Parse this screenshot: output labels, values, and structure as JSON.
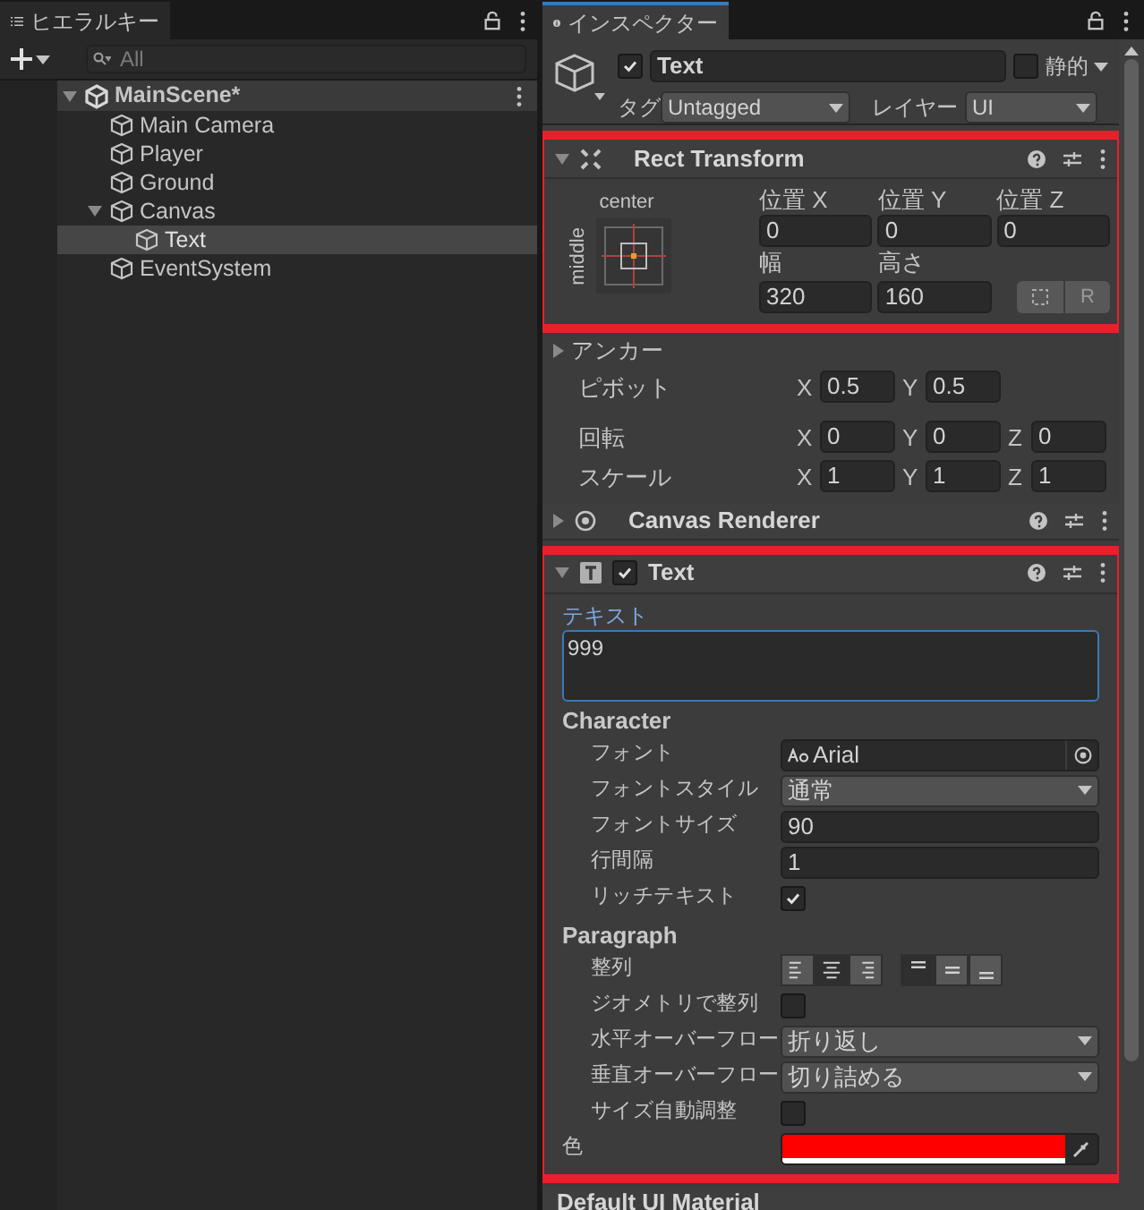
{
  "hierarchy": {
    "tab": "ヒエラルキー",
    "search": {
      "placeholder": "All"
    },
    "tree": [
      {
        "label": "MainScene*",
        "kind": "scene",
        "expanded": true,
        "selected": false,
        "children": [
          {
            "label": "Main Camera",
            "kind": "object",
            "selected": false
          },
          {
            "label": "Player",
            "kind": "object",
            "selected": false
          },
          {
            "label": "Ground",
            "kind": "object",
            "selected": false
          },
          {
            "label": "Canvas",
            "kind": "object",
            "expanded": true,
            "selected": false,
            "children": [
              {
                "label": "Text",
                "kind": "object",
                "selected": true
              }
            ]
          },
          {
            "label": "EventSystem",
            "kind": "object",
            "selected": false
          }
        ]
      }
    ]
  },
  "inspector": {
    "tab": "インスペクター",
    "object": {
      "active": true,
      "name": "Text",
      "static_label": "静的",
      "static": false,
      "tag_label": "タグ",
      "tag": "Untagged",
      "layer_label": "レイヤー",
      "layer": "UI"
    },
    "rect_transform": {
      "title": "Rect Transform",
      "anchor_h": "center",
      "anchor_v": "middle",
      "position": [
        {
          "label": "位置 X",
          "value": "0"
        },
        {
          "label": "位置 Y",
          "value": "0"
        },
        {
          "label": "位置 Z",
          "value": "0"
        }
      ],
      "size": [
        {
          "label": "幅",
          "value": "320"
        },
        {
          "label": "高さ",
          "value": "160"
        }
      ],
      "raw_button": "R",
      "anchors": {
        "label": "アンカー",
        "expanded": false
      },
      "rows": [
        {
          "label": "ピボット",
          "axes": [
            {
              "axis": "X",
              "value": "0.5"
            },
            {
              "axis": "Y",
              "value": "0.5"
            }
          ]
        },
        {
          "label": "回転",
          "axes": [
            {
              "axis": "X",
              "value": "0"
            },
            {
              "axis": "Y",
              "value": "0"
            },
            {
              "axis": "Z",
              "value": "0"
            }
          ]
        },
        {
          "label": "スケール",
          "axes": [
            {
              "axis": "X",
              "value": "1"
            },
            {
              "axis": "Y",
              "value": "1"
            },
            {
              "axis": "Z",
              "value": "1"
            }
          ]
        }
      ]
    },
    "canvas_renderer": {
      "title": "Canvas Renderer",
      "expanded": false
    },
    "text_component": {
      "title": "Text",
      "enabled": true,
      "text_label": "テキスト",
      "text": "999",
      "props": [
        {
          "kind": "section",
          "label": "Character"
        },
        {
          "kind": "object",
          "label": "フォント",
          "value": "Arial"
        },
        {
          "kind": "dropdown",
          "label": "フォントスタイル",
          "value": "通常"
        },
        {
          "kind": "number",
          "label": "フォントサイズ",
          "value": "90"
        },
        {
          "kind": "number",
          "label": "行間隔",
          "value": "1"
        },
        {
          "kind": "checkbox",
          "label": "リッチテキスト",
          "checked": true
        },
        {
          "kind": "section",
          "label": "Paragraph"
        },
        {
          "kind": "alignment",
          "label": "整列",
          "horizontal": [
            {
              "selected": false
            },
            {
              "selected": true
            },
            {
              "selected": false
            }
          ],
          "vertical": [
            {
              "selected": true
            },
            {
              "selected": false
            },
            {
              "selected": false
            }
          ]
        },
        {
          "kind": "checkbox",
          "label": "ジオメトリで整列",
          "checked": false
        },
        {
          "kind": "dropdown",
          "label": "水平オーバーフロー",
          "value": "折り返し"
        },
        {
          "kind": "dropdown",
          "label": "垂直オーバーフロー",
          "value": "切り詰める"
        },
        {
          "kind": "checkbox",
          "label": "サイズ自動調整",
          "checked": false
        },
        {
          "kind": "color",
          "label": "色",
          "color": "#ff0000"
        }
      ]
    },
    "material": {
      "title": "Default UI Material"
    }
  }
}
